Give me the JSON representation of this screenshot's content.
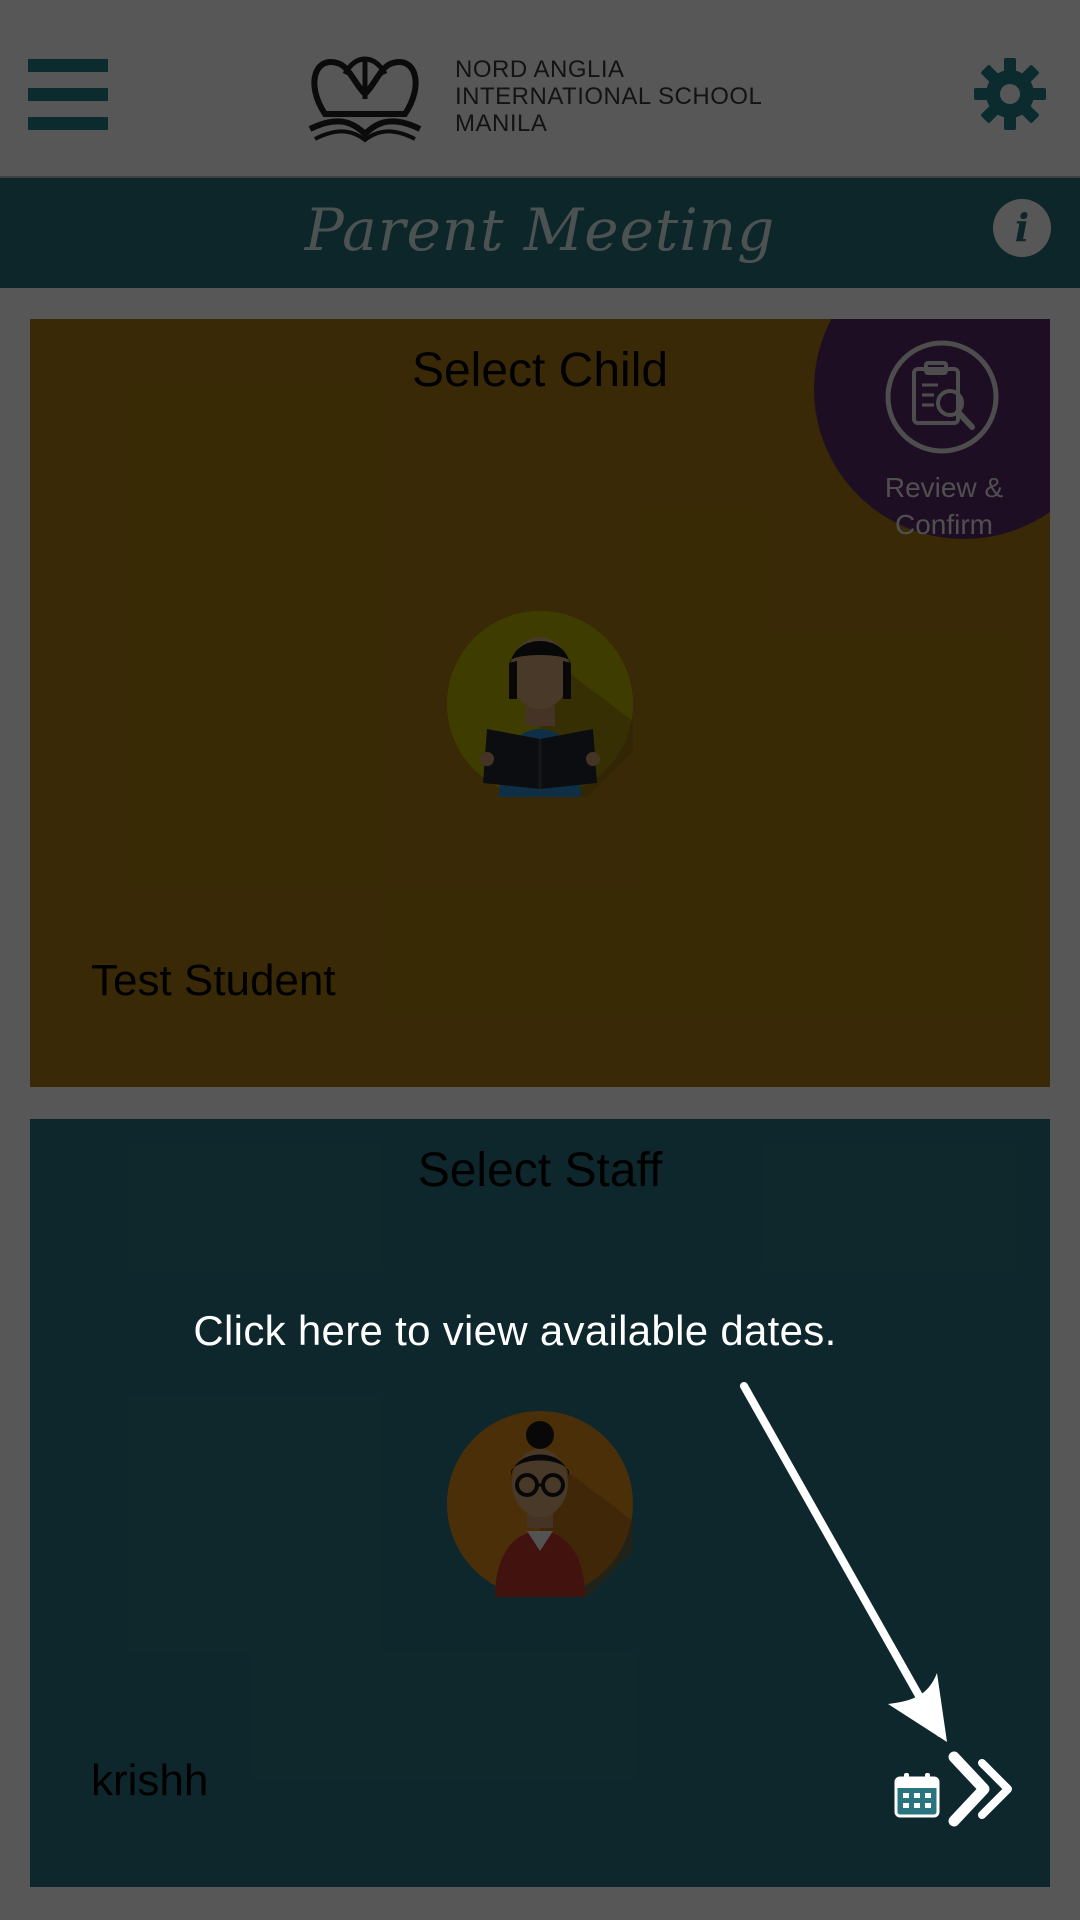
{
  "header": {
    "school_name_line1": "NORD ANGLIA",
    "school_name_line2": "INTERNATIONAL SCHOOL",
    "school_name_line3": "MANILA",
    "menu_icon": "hamburger-menu-icon",
    "settings_icon": "gear-icon"
  },
  "title_bar": {
    "title": "Parent Meeting",
    "info_label": "i"
  },
  "child_card": {
    "title": "Select Child",
    "name": "Test Student",
    "avatar_icon": "student-reading-avatar"
  },
  "review_badge": {
    "label": "Review & Confirm",
    "icon": "clipboard-search-icon"
  },
  "staff_card": {
    "title": "Select Staff",
    "name": "krishh",
    "avatar_icon": "teacher-avatar",
    "next_icons": [
      "calendar-icon",
      "double-chevron-right-icon"
    ]
  },
  "overlay": {
    "hint": "Click here to view available dates."
  },
  "colors": {
    "primary_teal": "#25707a",
    "accent_teal": "#247e8a",
    "child_card": "#a67a13",
    "staff_card": "#2a7480",
    "review_purple": "#5a2a6a"
  }
}
